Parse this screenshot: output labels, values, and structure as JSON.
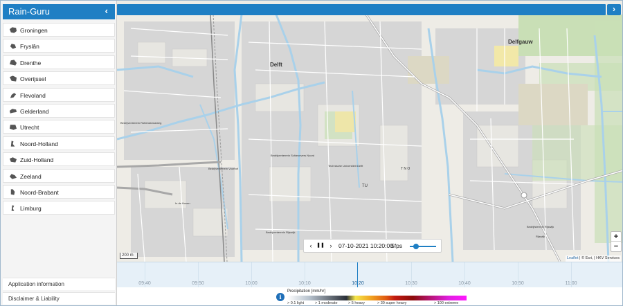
{
  "app": {
    "title": "Rain-Guru",
    "collapse_icon": "‹",
    "expand_icon": "›"
  },
  "provinces": [
    {
      "name": "Groningen",
      "icon": "groningen-icon"
    },
    {
      "name": "Fryslân",
      "icon": "fryslan-icon"
    },
    {
      "name": "Drenthe",
      "icon": "drenthe-icon"
    },
    {
      "name": "Overijssel",
      "icon": "overijssel-icon"
    },
    {
      "name": "Flevoland",
      "icon": "flevoland-icon"
    },
    {
      "name": "Gelderland",
      "icon": "gelderland-icon"
    },
    {
      "name": "Utrecht",
      "icon": "utrecht-icon"
    },
    {
      "name": "Noord-Holland",
      "icon": "noord-holland-icon"
    },
    {
      "name": "Zuid-Holland",
      "icon": "zuid-holland-icon"
    },
    {
      "name": "Zeeland",
      "icon": "zeeland-icon"
    },
    {
      "name": "Noord-Brabant",
      "icon": "noord-brabant-icon"
    },
    {
      "name": "Limburg",
      "icon": "limburg-icon"
    }
  ],
  "footer": {
    "info": "Application information",
    "disclaimer": "Disclaimer & Liability"
  },
  "map": {
    "labels": {
      "delft": "Delft",
      "delfgauw": "Delfgauw",
      "tu": "TU",
      "tno": "T N O",
      "tu_campus": "Technische Universiteit Delft",
      "ind_west": "Bedrijventerrein Rotterdamseweg",
      "ind_schie": "Bedrijventerrein Schieoevers Noord",
      "ind_voorhof": "Bedrijventerrein Voorhof",
      "ind_rijswijk": "Bedrijventerrein Rijswijk",
      "ind_koepoort": "Bedrijfsterrein Rijswijk",
      "hoven": "In de Hoven",
      "rijswijk": "Rijswijk"
    },
    "scale": "200 m",
    "attribution_leaflet": "Leaflet",
    "attribution_rest": " | © Esri, | HKV Services"
  },
  "player": {
    "prev": "‹",
    "pause": "❚❚",
    "next": "›",
    "datetime": "07-10-2021 10:20:00",
    "fps": "5fps"
  },
  "zoom": {
    "in": "+",
    "out": "−"
  },
  "timeline": {
    "ticks": [
      "09:40",
      "09:50",
      "10:00",
      "10:10",
      "10:20",
      "10:30",
      "10:40",
      "10:50",
      "11:00"
    ],
    "current": "10:20"
  },
  "legend": {
    "title": "Precipitation [mm/hr]",
    "info_icon": "i",
    "labels": [
      "> 0.1 light",
      "> 1 moderate",
      "> 5 heavy",
      "> 30 super heavy",
      "> 100 extreme"
    ]
  },
  "colors": {
    "accent": "#1f7fc4",
    "sidebar_bg": "#f4f4f4"
  }
}
